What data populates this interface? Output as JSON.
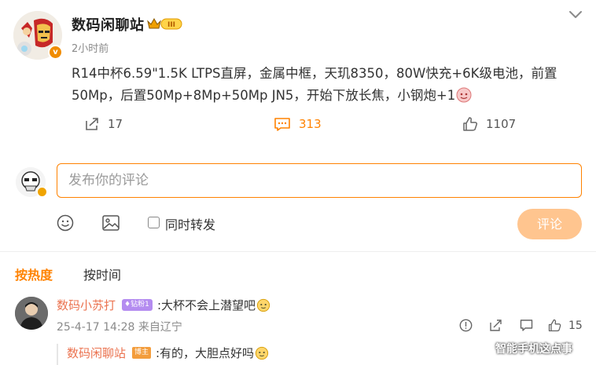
{
  "post": {
    "author_name": "数码闲聊站",
    "level_badge": "III",
    "time": "2小时前",
    "content": "R14中杯6.59\"1.5K LTPS直屏，金属中框，天玑8350，80W快充+6K级电池，前置50Mp，后置50Mp+8Mp+50Mp JN5，开始下放长焦，小钢炮+1",
    "content_emoji": "emoji-face-icon",
    "stats": {
      "repost_count": "17",
      "comment_count": "313",
      "like_count": "1107"
    }
  },
  "composer": {
    "placeholder": "发布你的评论",
    "repost_label": "同时转发",
    "submit_label": "评论"
  },
  "sort_tabs": {
    "hot": "按热度",
    "time": "按时间"
  },
  "comments": [
    {
      "user": "数码小苏打",
      "vip_badge": "钻粉1",
      "text": ":大杯不会上潜望吧",
      "text_emoji": "emoji-face-icon",
      "meta": "25-4-17 14:28 来自辽宁",
      "like_count": "15",
      "reply": {
        "user": "数码闲聊站",
        "tag": "博主",
        "text": ":有的，大胆点好吗"
      }
    }
  ],
  "watermark": "智能手机这点事",
  "colors": {
    "accent": "#ff8200",
    "username": "#eb7350",
    "submit_disabled": "#ffc58f"
  }
}
